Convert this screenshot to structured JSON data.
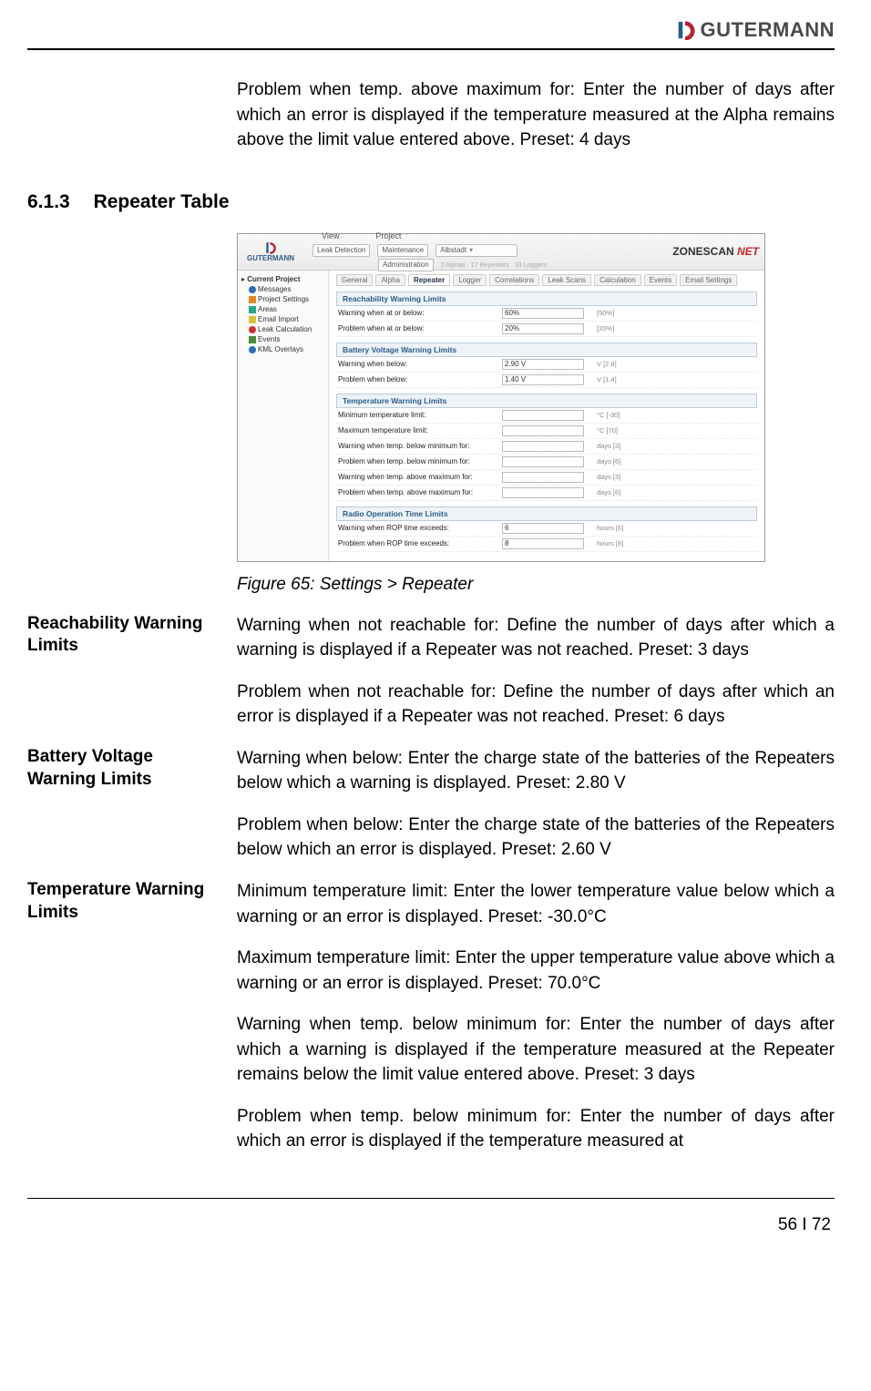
{
  "header": {
    "company": "GUTERMANN"
  },
  "intro_paragraph": "Problem when temp. above maximum for: Enter the number of days after which an error is displayed if the temperature measured at the Alpha remains above the limit value entered above. Preset: 4 days",
  "section": {
    "number": "6.1.3",
    "title": "Repeater Table"
  },
  "figure_caption": "Figure 65: Settings > Repeater",
  "screenshot": {
    "brand_left": "GUTERMANN",
    "brand_right_main": "ZONESCAN",
    "brand_right_net": "NET",
    "top_menu": {
      "view": "View",
      "project": "Project"
    },
    "top_row2": {
      "leak_detection": "Leak Detection",
      "maintenance": "Maintenance",
      "administration": "Administration",
      "project_select": "Albstadt",
      "project_sub": "2 Alphas · 17 Repeaters · 33 Loggers"
    },
    "tree": {
      "root": "Current Project",
      "items": [
        "Messages",
        "Project Settings",
        "Areas",
        "Email Import",
        "Leak Calculation",
        "Events",
        "KML Overlays"
      ]
    },
    "subtabs": [
      "General",
      "Alpha",
      "Repeater",
      "Logger",
      "Correlations",
      "Leak Scans",
      "Calculation",
      "Events",
      "Email Settings"
    ],
    "sections": [
      {
        "title": "Reachability Warning Limits",
        "rows": [
          {
            "label": "Warning when at or below:",
            "value": "60%",
            "unit": "[50%]",
            "select": true
          },
          {
            "label": "Problem when at or below:",
            "value": "20%",
            "unit": "[20%]",
            "select": true
          }
        ]
      },
      {
        "title": "Battery Voltage Warning Limits",
        "rows": [
          {
            "label": "Warning when below:",
            "value": "2.90 V",
            "unit": "V [2.8]"
          },
          {
            "label": "Problem when below:",
            "value": "1.40 V",
            "unit": "V [1.4]"
          }
        ]
      },
      {
        "title": "Temperature Warning Limits",
        "rows": [
          {
            "label": "Minimum temperature limit:",
            "value": "",
            "unit": "°C [-30]"
          },
          {
            "label": "Maximum temperature limit:",
            "value": "",
            "unit": "°C [70]"
          },
          {
            "label": "Warning when temp. below minimum for:",
            "value": "",
            "unit": "days [3]"
          },
          {
            "label": "Problem when temp. below minimum for:",
            "value": "",
            "unit": "days [6]"
          },
          {
            "label": "Warning when temp. above maximum for:",
            "value": "",
            "unit": "days [3]"
          },
          {
            "label": "Problem when temp. above maximum for:",
            "value": "",
            "unit": "days [6]"
          }
        ]
      },
      {
        "title": "Radio Operation Time Limits",
        "rows": [
          {
            "label": "Warning when ROP time exceeds:",
            "value": "6",
            "unit": "hours [6]"
          },
          {
            "label": "Problem when ROP time exceeds:",
            "value": "8",
            "unit": "hours [8]"
          }
        ]
      }
    ]
  },
  "definitions": [
    {
      "label": "Reachability Warning Limits",
      "paragraphs": [
        "Warning when not reachable for: Define the number of days after which a warning is displayed if a Repeater was not reached. Preset: 3 days",
        "Problem when not reachable for: Define the number of days after which an error is displayed if a Repeater was not reached. Preset: 6 days"
      ]
    },
    {
      "label": "Battery Voltage Warning Limits",
      "paragraphs": [
        "Warning when below: Enter the charge state of the batteries of the Repeaters below which a warning is displayed. Preset: 2.80 V",
        "Problem when below: Enter the charge state of the batteries of the Repeaters below which an error is displayed. Preset: 2.60 V"
      ]
    },
    {
      "label": "Temperature Warning Limits",
      "paragraphs": [
        "Minimum temperature limit: Enter the lower temperature value below which a warning or an error is displayed. Preset: -30.0°C",
        "Maximum temperature limit: Enter the upper temperature value above which a warning or an error is displayed. Preset: 70.0°C",
        "Warning when temp. below minimum for: Enter the number of days after which a warning is displayed if the temperature measured at the Repeater remains below the limit value entered above. Preset: 3 days",
        "Problem when temp. below minimum for: Enter the number of days after which an error is displayed if the temperature measured at"
      ]
    }
  ],
  "page_number": "56 I 72"
}
